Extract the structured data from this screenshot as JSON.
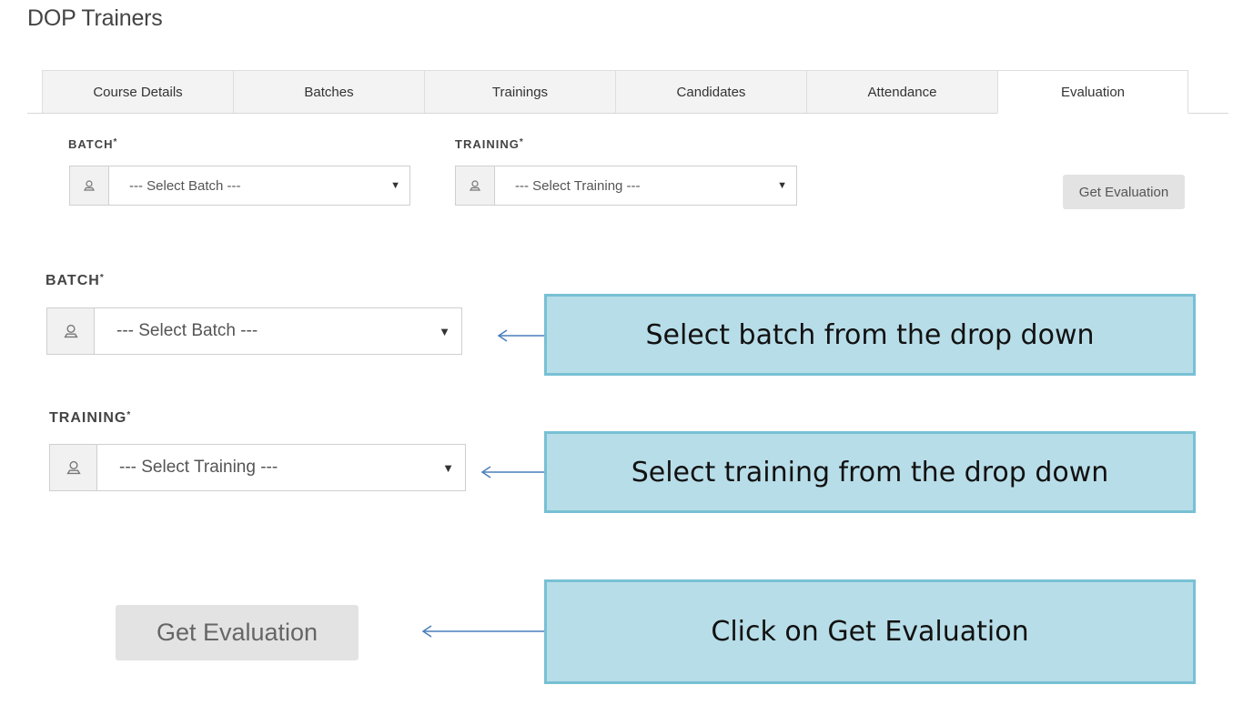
{
  "page": {
    "title": "DOP Trainers"
  },
  "tabs": [
    {
      "label": "Course Details"
    },
    {
      "label": "Batches"
    },
    {
      "label": "Trainings"
    },
    {
      "label": "Candidates"
    },
    {
      "label": "Attendance"
    },
    {
      "label": "Evaluation",
      "active": true
    }
  ],
  "form": {
    "batch_label": "BATCH",
    "training_label": "TRAINING",
    "required_mark": "*",
    "batch_select": {
      "value": "--- Select Batch ---"
    },
    "training_select": {
      "value": "--- Select Training ---"
    },
    "get_evaluation_label": "Get Evaluation"
  },
  "zoom": {
    "batch_label": "BATCH",
    "training_label": "TRAINING",
    "required_mark": "*",
    "batch_select": {
      "value": "--- Select Batch ---"
    },
    "training_select": {
      "value": "--- Select Training ---"
    },
    "get_evaluation_label": "Get Evaluation"
  },
  "callouts": {
    "batch": "Select batch from the drop down",
    "training": "Select training from the drop down",
    "evaluate": "Click on Get Evaluation"
  },
  "icons": {
    "addon": "user-icon",
    "caret": "caret-down-icon",
    "arrow": "arrow-left-icon"
  },
  "colors": {
    "callout_fill": "#b7dde8",
    "callout_border": "#78c0d4",
    "arrow": "#4a7ebb"
  }
}
